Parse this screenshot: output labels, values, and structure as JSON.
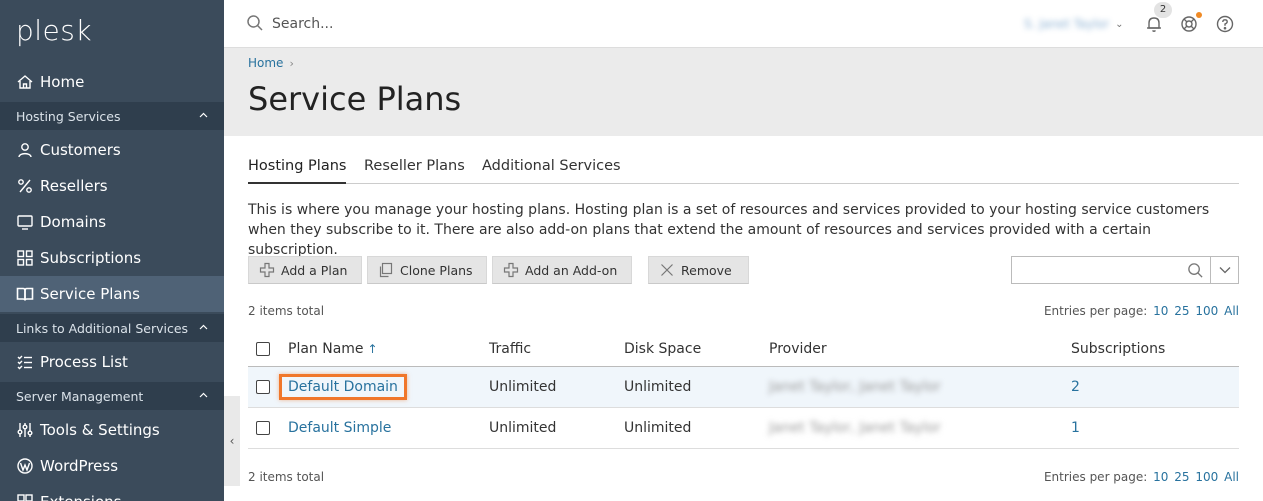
{
  "app": {
    "logo": "plesk"
  },
  "sidebar": {
    "home": "Home",
    "section_hosting": "Hosting Services",
    "customers": "Customers",
    "resellers": "Resellers",
    "domains": "Domains",
    "subscriptions": "Subscriptions",
    "service_plans": "Service Plans",
    "section_links": "Links to Additional Services",
    "process_list": "Process List",
    "section_server": "Server Management",
    "tools_settings": "Tools & Settings",
    "wordpress": "WordPress",
    "extensions": "Extensions"
  },
  "header": {
    "search_placeholder": "Search...",
    "user_name": "S. Janet Taylor",
    "notifications_count": "2"
  },
  "page": {
    "breadcrumb_home": "Home",
    "title": "Service Plans"
  },
  "tabs": {
    "hosting": "Hosting Plans",
    "reseller": "Reseller Plans",
    "additional": "Additional Services"
  },
  "description": "This is where you manage your hosting plans. Hosting plan is a set of resources and services provided to your hosting service customers when they subscribe to it. There are also add-on plans that extend the amount of resources and services provided with a certain subscription.",
  "toolbar": {
    "add_plan": "Add a Plan",
    "clone_plans": "Clone Plans",
    "add_addon": "Add an Add-on",
    "remove": "Remove"
  },
  "list": {
    "items_total": "2 items total",
    "entries_label": "Entries per page:",
    "entries_options": [
      "10",
      "25",
      "100",
      "All"
    ],
    "columns": {
      "plan_name": "Plan Name",
      "sort_indicator": "↑",
      "traffic": "Traffic",
      "disk_space": "Disk Space",
      "provider": "Provider",
      "subscriptions": "Subscriptions"
    },
    "rows": [
      {
        "name": "Default Domain",
        "traffic": "Unlimited",
        "disk": "Unlimited",
        "provider": "Janet Taylor, Janet Taylor",
        "subscriptions": "2"
      },
      {
        "name": "Default Simple",
        "traffic": "Unlimited",
        "disk": "Unlimited",
        "provider": "Janet Taylor, Janet Taylor",
        "subscriptions": "1"
      }
    ]
  }
}
